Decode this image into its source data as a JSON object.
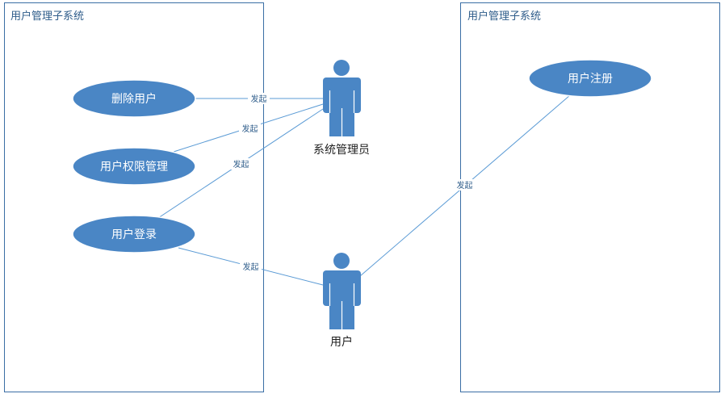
{
  "boundaries": [
    {
      "id": "left-subsystem",
      "title": "用户管理子系统"
    },
    {
      "id": "right-subsystem",
      "title": "用户管理子系统"
    }
  ],
  "use_cases": [
    {
      "id": "delete-user",
      "label": "删除用户"
    },
    {
      "id": "permission-management",
      "label": "用户权限管理"
    },
    {
      "id": "user-login",
      "label": "用户登录"
    },
    {
      "id": "user-register",
      "label": "用户注册"
    }
  ],
  "actors": [
    {
      "id": "admin",
      "label": "系统管理员"
    },
    {
      "id": "user",
      "label": "用户"
    }
  ],
  "associations": [
    {
      "from": "delete-user",
      "to": "admin",
      "label": "发起"
    },
    {
      "from": "permission-management",
      "to": "admin",
      "label": "发起"
    },
    {
      "from": "user-login",
      "to": "admin",
      "label": "发起"
    },
    {
      "from": "user-login",
      "to": "user",
      "label": "发起"
    },
    {
      "from": "user-register",
      "to": "user",
      "label": "发起"
    }
  ],
  "colors": {
    "use_case_fill": "#4a86c5",
    "actor_fill": "#4a86c5",
    "boundary_stroke": "#3a6ea5",
    "line_stroke": "#5b9bd5"
  }
}
